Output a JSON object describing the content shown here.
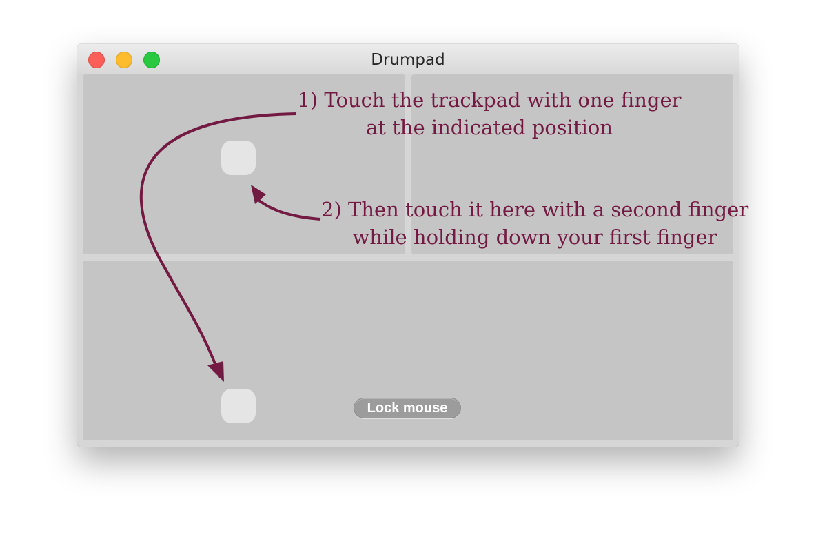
{
  "window": {
    "title": "Drumpad",
    "controls": [
      "close",
      "minimize",
      "zoom"
    ]
  },
  "pads": [
    {
      "name": "top-left-pad"
    },
    {
      "name": "top-right-pad"
    },
    {
      "name": "bottom-pad"
    }
  ],
  "lock_button": {
    "label": "Lock mouse"
  },
  "annotations": {
    "step1": {
      "line1": "1) Touch the trackpad with one finger",
      "line2": "at the indicated position"
    },
    "step2": {
      "line1": "2) Then touch it here with a second finger",
      "line2": "while holding down your first finger"
    }
  },
  "colors": {
    "annotation": "#731a42",
    "pad": "#c5c5c5",
    "touch_point": "#e5e5e5",
    "close": "#fc5f57",
    "minimize": "#fdbc2e",
    "zoom": "#28c840"
  },
  "icons": [
    "close-icon",
    "minimize-icon",
    "zoom-icon",
    "arrow-icon"
  ]
}
